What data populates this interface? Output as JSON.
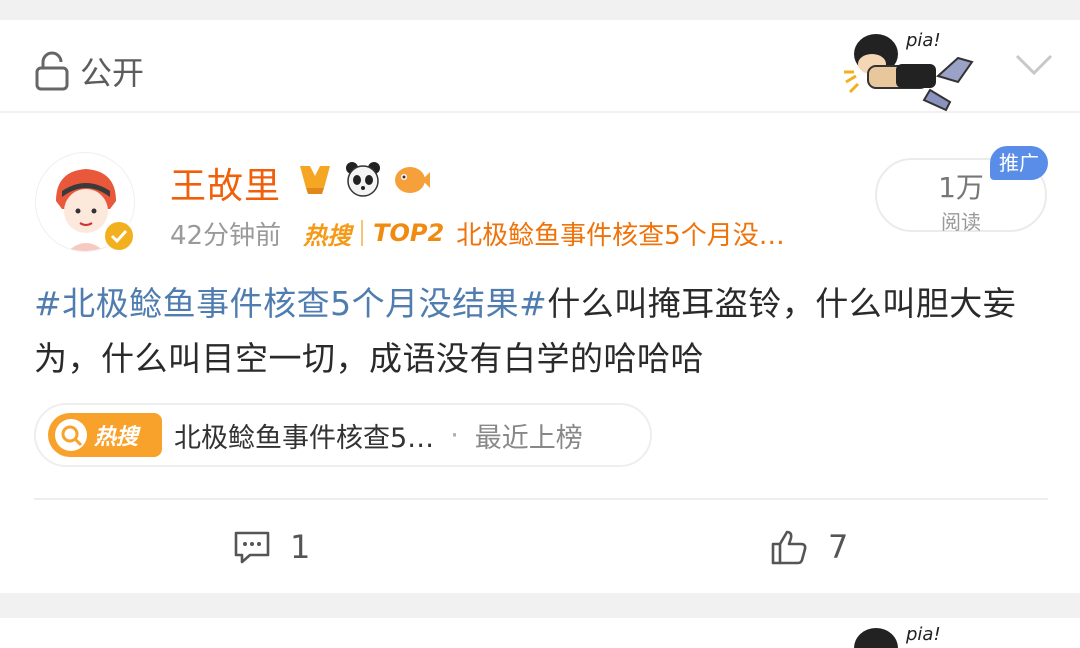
{
  "visibility": {
    "label": "公开",
    "icon": "lock-icon"
  },
  "post": {
    "username": "王故里",
    "time": "42分钟前",
    "hot_logo": "热搜",
    "rank": "TOP2",
    "hot_title": "北极鲶鱼事件核查5个月没…",
    "read_count": "1万",
    "read_label": "阅读",
    "ad_tag": "推广",
    "hashtag": "#北极鲶鱼事件核查5个月没结果#",
    "text": "什么叫掩耳盗铃，什么叫胆大妄为，什么叫目空一切，成语没有白学的哈哈哈",
    "hot_pill": {
      "logo": "热搜",
      "title": "北极鲶鱼事件核查5…",
      "dot": "·",
      "status": "最近上榜"
    },
    "comments": "1",
    "likes": "7"
  },
  "sticker_text": "pia!",
  "colors": {
    "username": "#f15f0a",
    "hashtag": "#507daf",
    "hot": "#f59a18",
    "ad": "#5a8de8"
  }
}
